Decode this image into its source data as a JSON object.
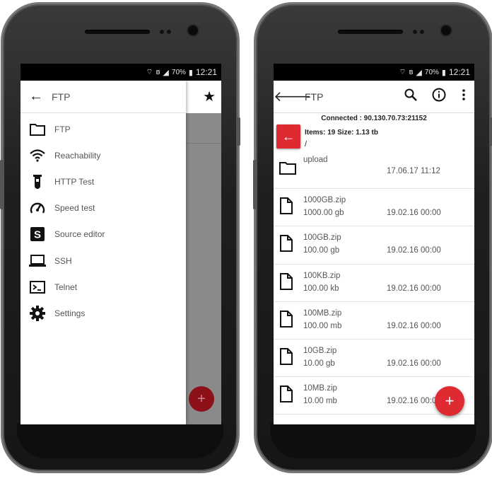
{
  "status_bar": {
    "time": "12:21",
    "battery": "70%"
  },
  "left_screen": {
    "drawer": {
      "title": "FTP",
      "items": [
        {
          "label": "FTP",
          "icon": "folder-icon"
        },
        {
          "label": "Reachability",
          "icon": "wifi-icon"
        },
        {
          "label": "HTTP Test",
          "icon": "test-tube-icon"
        },
        {
          "label": "Speed test",
          "icon": "speedometer-icon"
        },
        {
          "label": "Source editor",
          "icon": "source-s-icon"
        },
        {
          "label": "SSH",
          "icon": "laptop-icon"
        },
        {
          "label": "Telnet",
          "icon": "terminal-icon"
        },
        {
          "label": "Settings",
          "icon": "gear-icon"
        }
      ]
    },
    "fab_label": "+"
  },
  "right_screen": {
    "title": "FTP",
    "connected": "Connected : 90.130.70.73:21152",
    "items_info": "Items: 19 Size: 1.13 tb",
    "path": "/",
    "files": [
      {
        "name": "upload",
        "size": "",
        "date": "17.06.17 11:12",
        "type": "folder"
      },
      {
        "name": "1000GB.zip",
        "size": "1000.00 gb",
        "date": "19.02.16 00:00",
        "type": "file"
      },
      {
        "name": "100GB.zip",
        "size": "100.00 gb",
        "date": "19.02.16 00:00",
        "type": "file"
      },
      {
        "name": "100KB.zip",
        "size": "100.00 kb",
        "date": "19.02.16 00:00",
        "type": "file"
      },
      {
        "name": "100MB.zip",
        "size": "100.00 mb",
        "date": "19.02.16 00:00",
        "type": "file"
      },
      {
        "name": "10GB.zip",
        "size": "10.00 gb",
        "date": "19.02.16 00:00",
        "type": "file"
      },
      {
        "name": "10MB.zip",
        "size": "10.00 mb",
        "date": "19.02.16 00:00",
        "type": "file"
      }
    ],
    "fab_label": "+"
  },
  "colors": {
    "accent": "#e02a32",
    "phone_body": "#1f1f1f"
  }
}
